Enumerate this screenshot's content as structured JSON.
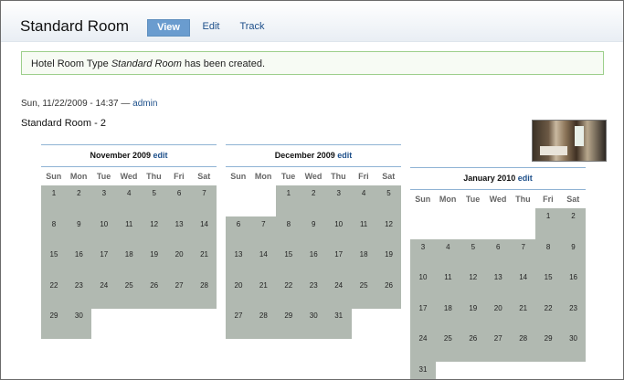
{
  "header": {
    "title": "Standard Room",
    "tabs": [
      {
        "label": "View",
        "active": true
      },
      {
        "label": "Edit",
        "active": false
      },
      {
        "label": "Track",
        "active": false
      }
    ]
  },
  "notice": {
    "prefix": "Hotel Room Type ",
    "name": "Standard Room",
    "suffix": " has been created."
  },
  "submitted": {
    "datetime": "Sun, 11/22/2009 - 14:37",
    "separator": " — ",
    "author": "admin"
  },
  "node": {
    "title": "Standard Room - 2",
    "photo_icon": "room-photo"
  },
  "calendars": [
    {
      "month": "November 2009",
      "edit": "edit",
      "first_weekday": 0,
      "days": 30
    },
    {
      "month": "December 2009",
      "edit": "edit",
      "first_weekday": 2,
      "days": 31
    },
    {
      "month": "January 2010",
      "edit": "edit",
      "first_weekday": 5,
      "days": 31
    }
  ],
  "weekdays": [
    "Sun",
    "Mon",
    "Tue",
    "Wed",
    "Thu",
    "Fri",
    "Sat"
  ],
  "colors": {
    "available": "#b1b9b1",
    "tab_active": "#6a9ccf",
    "link": "#1d4f8a",
    "notice_border": "#9dcf8c"
  }
}
